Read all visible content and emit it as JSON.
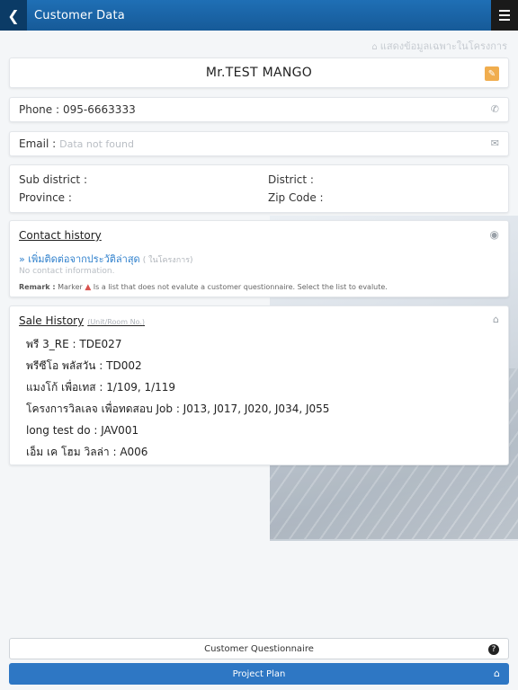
{
  "header": {
    "title": "Customer Data",
    "back_icon": "chevron-left-icon",
    "menu_icon": "hamburger-icon"
  },
  "filter_note": "แสดงข้อมูลเฉพาะในโครงการ",
  "customer": {
    "name": "Mr.TEST MANGO"
  },
  "phone": {
    "label": "Phone :",
    "value": "095-6663333"
  },
  "email": {
    "label": "Email :",
    "value": "Data not found"
  },
  "address": {
    "sub_district_label": "Sub district :",
    "district_label": "District :",
    "province_label": "Province :",
    "zip_label": "Zip Code :"
  },
  "contact_history": {
    "title": "Contact history",
    "add_label": "» เพิ่มติดต่อจากประวัติล่าสุด",
    "add_hint": "( ในโครงการ)",
    "empty_text": "No contact information.",
    "remark_label": "Remark :",
    "remark_prefix": "Marker",
    "remark_text": "Is a list that does not evalute a customer questionnaire. Select the list to evalute."
  },
  "sale_history": {
    "title": "Sale History",
    "subtitle": "(Unit/Room No.)",
    "items": [
      "พรี 3_RE : TDE027",
      "พรีซีโอ พลัสวัน : TD002",
      "แมงโก้ เพื่อเทส : 1/109, 1/119",
      "โครงการวิลเลจ เพื่อทดสอบ Job : J013, J017, J020, J034, J055",
      "long test do : JAV001",
      "เอ็ม เค โฮม วิลล่า : A006"
    ]
  },
  "buttons": {
    "questionnaire": "Customer Questionnaire",
    "project_plan": "Project Plan"
  },
  "colors": {
    "header": "#1f6fb5",
    "primary_button": "#2e77c4",
    "edit": "#f0ad4e",
    "link": "#2d7fcc"
  }
}
